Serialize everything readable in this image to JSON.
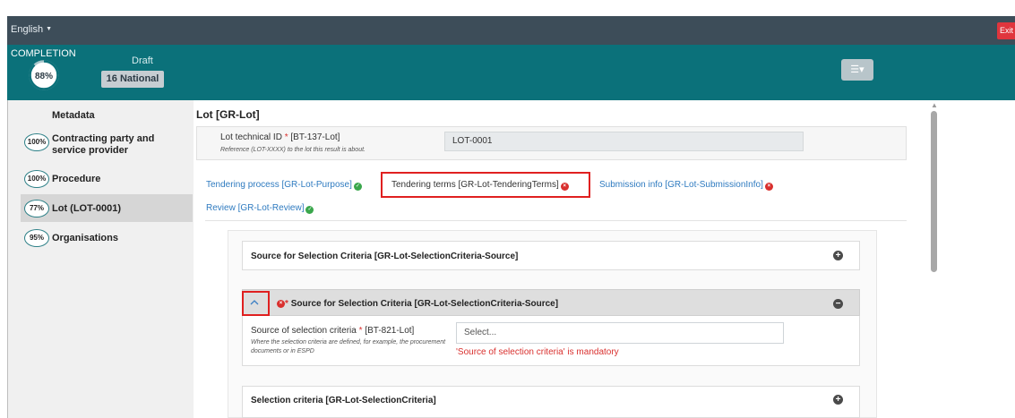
{
  "topbar": {
    "language": "English",
    "exit_label": "Exit"
  },
  "header": {
    "completion_label": "COMPLETION",
    "completion_percent": "88%",
    "completion_value": 0.88,
    "status": "Draft",
    "notice_type": "16 National"
  },
  "sidebar": {
    "title": "Metadata",
    "items": [
      {
        "badge": "100%",
        "label_line1": "Contracting party and",
        "label_line2": "service provider"
      },
      {
        "badge": "100%",
        "label_line1": "Procedure",
        "label_line2": ""
      },
      {
        "badge": "77%",
        "label_line1": "Lot (LOT-0001)",
        "label_line2": ""
      },
      {
        "badge": "95%",
        "label_line1": "Organisations",
        "label_line2": ""
      }
    ]
  },
  "main": {
    "title": "Lot [GR-Lot]",
    "lot_field": {
      "label": "Lot technical ID",
      "code": " [BT-137-Lot]",
      "help": "Reference (LOT-XXXX) to the lot this result is about.",
      "value": "LOT-0001"
    },
    "tabs": [
      {
        "label": "Tendering process  [GR-Lot-Purpose]",
        "status": "ok"
      },
      {
        "label": "Tendering terms  [GR-Lot-TenderingTerms]",
        "status": "error"
      },
      {
        "label": "Submission info  [GR-Lot-SubmissionInfo]",
        "status": "error"
      },
      {
        "label": "Review  [GR-Lot-Review]",
        "status": "ok"
      }
    ],
    "sections": {
      "first_title": "Source for Selection Criteria  [GR-Lot-SelectionCriteria-Source]",
      "second_title": "Source for Selection Criteria  [GR-Lot-SelectionCriteria-Source]",
      "third_title": "Selection criteria  [GR-Lot-SelectionCriteria]"
    },
    "source_field": {
      "label": "Source of selection criteria",
      "code": " [BT-821-Lot]",
      "help": "Where the selection criteria are defined, for example, the procurement documents or in ESPD",
      "placeholder": "Select...",
      "error": "'Source of selection criteria' is mandatory"
    }
  },
  "colors": {
    "topbar": "#3d4d59",
    "header": "#0b717a",
    "link": "#2f7bc0",
    "error": "#d9302e",
    "ok": "#3aa74c",
    "highlight": "#e02020"
  }
}
